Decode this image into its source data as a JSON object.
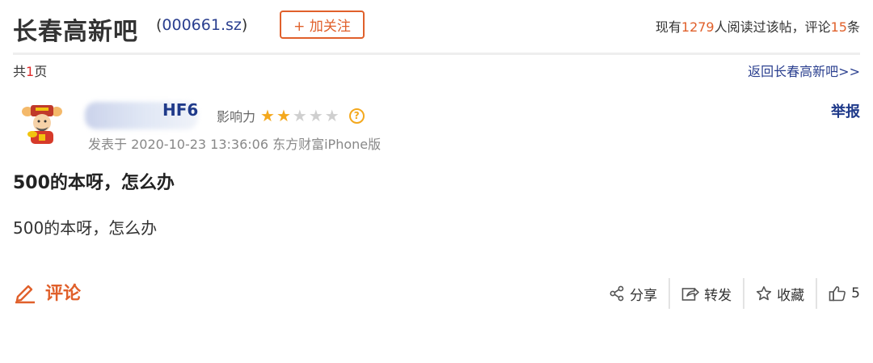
{
  "header": {
    "title": "长春高新吧",
    "stock_code": "000661.sz",
    "follow_label": "+ 加关注",
    "stats": {
      "prefix": "现有",
      "reads": "1279",
      "mid": "人阅读过该帖，评论",
      "comments": "15",
      "suffix": "条"
    }
  },
  "pager": {
    "prefix": "共",
    "total": "1",
    "suffix": "页"
  },
  "back_link": "返回长春高新吧>>",
  "post": {
    "author_tail": "HF6",
    "influence_label": "影响力",
    "stars_on": 2,
    "stars_total": 5,
    "meta": "发表于 2020-10-23 13:36:06 东方财富iPhone版",
    "report_label": "举报",
    "title": "500的本呀，怎么办",
    "body": "500的本呀，怎么办"
  },
  "footer": {
    "comment_label": "评论",
    "share_label": "分享",
    "forward_label": "转发",
    "favorite_label": "收藏",
    "like_count": "5"
  },
  "colors": {
    "accent": "#e0602b",
    "link": "#2a3f8f",
    "star": "#f4a81d"
  }
}
